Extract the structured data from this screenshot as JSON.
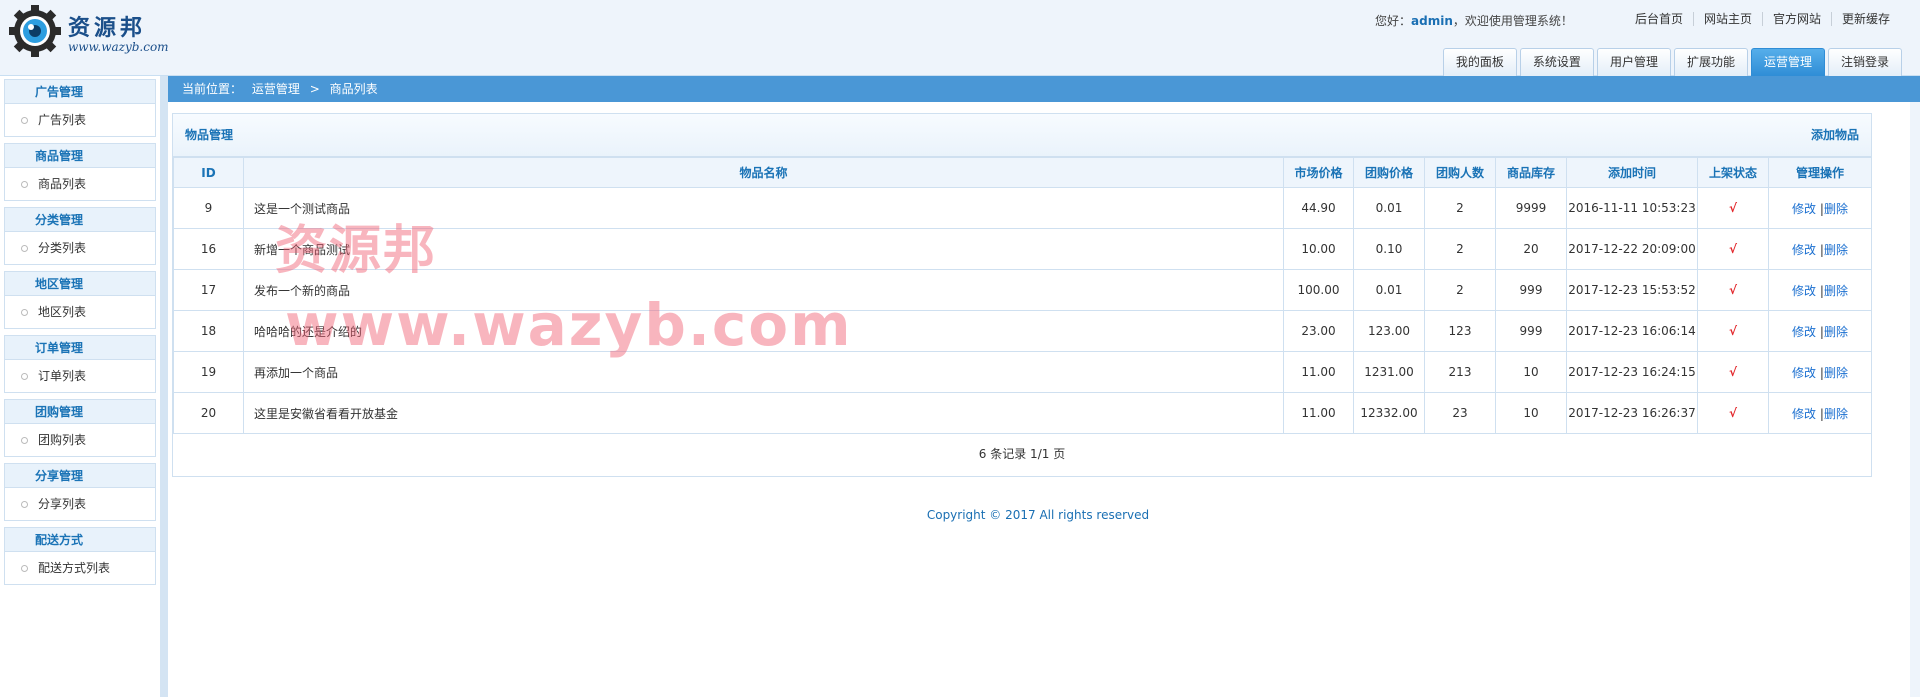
{
  "brand": {
    "name": "资源邦",
    "url": "www.wazyb.com"
  },
  "header": {
    "welcome_prefix": "您好：",
    "username": "admin",
    "welcome_suffix": "，欢迎使用管理系统！",
    "links": [
      "后台首页",
      "网站主页",
      "官方网站",
      "更新缓存"
    ],
    "tabs": [
      "我的面板",
      "系统设置",
      "用户管理",
      "扩展功能",
      "运营管理",
      "注销登录"
    ],
    "active_tab": "运营管理"
  },
  "sidebar": {
    "groups": [
      {
        "title": "广告管理",
        "item": "广告列表"
      },
      {
        "title": "商品管理",
        "item": "商品列表"
      },
      {
        "title": "分类管理",
        "item": "分类列表"
      },
      {
        "title": "地区管理",
        "item": "地区列表"
      },
      {
        "title": "订单管理",
        "item": "订单列表"
      },
      {
        "title": "团购管理",
        "item": "团购列表"
      },
      {
        "title": "分享管理",
        "item": "分享列表"
      },
      {
        "title": "配送方式",
        "item": "配送方式列表"
      }
    ]
  },
  "breadcrumb": {
    "label": "当前位置：",
    "section": "运营管理",
    "arrow": ">",
    "page": "商品列表"
  },
  "panel": {
    "title": "物品管理",
    "add_label": "添加物品",
    "columns": [
      "ID",
      "物品名称",
      "市场价格",
      "团购价格",
      "团购人数",
      "商品库存",
      "添加时间",
      "上架状态",
      "管理操作"
    ],
    "rows": [
      {
        "id": "9",
        "name": "这是一个测试商品",
        "market": "44.90",
        "group": "0.01",
        "people": "2",
        "stock": "9999",
        "time": "2016-11-11 10:53:23",
        "status": "√"
      },
      {
        "id": "16",
        "name": "新增一个商品测试",
        "market": "10.00",
        "group": "0.10",
        "people": "2",
        "stock": "20",
        "time": "2017-12-22 20:09:00",
        "status": "√"
      },
      {
        "id": "17",
        "name": "发布一个新的商品",
        "market": "100.00",
        "group": "0.01",
        "people": "2",
        "stock": "999",
        "time": "2017-12-23 15:53:52",
        "status": "√"
      },
      {
        "id": "18",
        "name": "哈哈哈的还是介绍的",
        "market": "23.00",
        "group": "123.00",
        "people": "123",
        "stock": "999",
        "time": "2017-12-23 16:06:14",
        "status": "√"
      },
      {
        "id": "19",
        "name": "再添加一个商品",
        "market": "11.00",
        "group": "1231.00",
        "people": "213",
        "stock": "10",
        "time": "2017-12-23 16:24:15",
        "status": "√"
      },
      {
        "id": "20",
        "name": "这里是安徽省看看开放基金",
        "market": "11.00",
        "group": "12332.00",
        "people": "23",
        "stock": "10",
        "time": "2017-12-23 16:26:37",
        "status": "√"
      }
    ],
    "edit_label": "修改",
    "action_sep": "|",
    "delete_label": "删除",
    "pager": "6 条记录 1/1 页"
  },
  "footer": {
    "copyright": "Copyright © 2017 All rights reserved"
  },
  "watermark": {
    "cn": "资源邦",
    "url": "www.wazyb.com"
  },
  "colors": {
    "accent": "#4a97d6",
    "link": "#1a73b6",
    "tick": "#e2262b"
  }
}
